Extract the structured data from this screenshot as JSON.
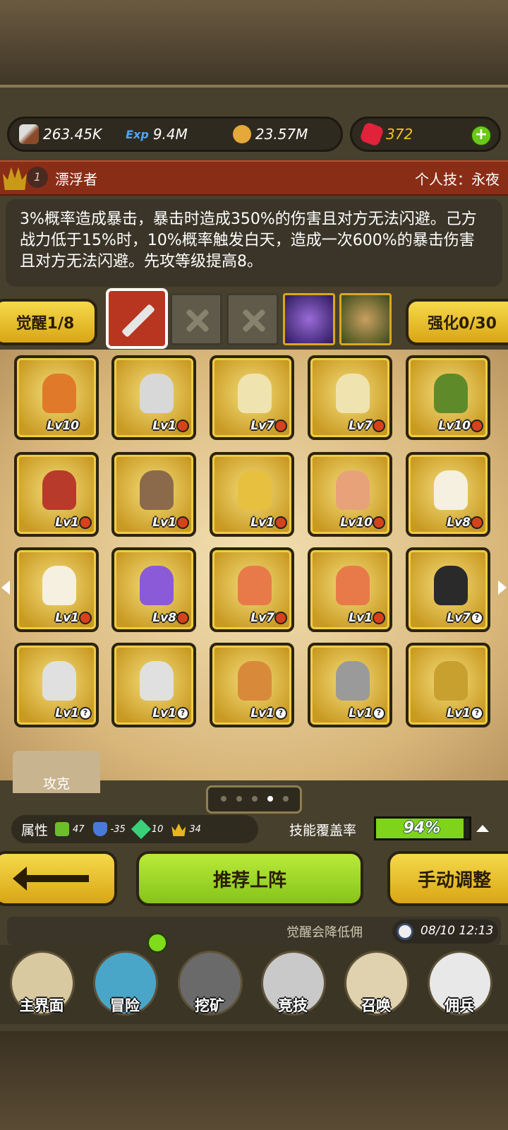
{
  "resources": {
    "power": "263.45K",
    "exp_label": "Exp",
    "exp": "9.4M",
    "gold": "23.57M",
    "gems": "372"
  },
  "hero": {
    "rank": "1",
    "name": "漂浮者",
    "skill": "个人技：永夜",
    "description": "3%概率造成暴击，暴击时造成350%的伤害且对方无法闪避。己方战力低于15%时，10%概率触发白天，造成一次600%的暴击伤害且对方无法闪避。先攻等级提高8。"
  },
  "awaken": {
    "label": "觉醒1/8"
  },
  "enhance": {
    "label": "强化0/30"
  },
  "roster": [
    {
      "level": "Lv10",
      "mark": "",
      "color": "#e07a2a"
    },
    {
      "level": "Lv1",
      "mark": "red",
      "color": "#d8d8d8"
    },
    {
      "level": "Lv7",
      "mark": "red",
      "color": "#efe3b0"
    },
    {
      "level": "Lv7",
      "mark": "red",
      "color": "#efe3b0"
    },
    {
      "level": "Lv10",
      "mark": "red",
      "color": "#5f8a2a"
    },
    {
      "level": "Lv1",
      "mark": "red",
      "color": "#b83a2a"
    },
    {
      "level": "Lv1",
      "mark": "red",
      "color": "#8a6a4a"
    },
    {
      "level": "Lv1",
      "mark": "red",
      "color": "#e8c040"
    },
    {
      "level": "Lv10",
      "mark": "red",
      "color": "#e8a27a"
    },
    {
      "level": "Lv8",
      "mark": "red",
      "color": "#f5f0e0"
    },
    {
      "level": "Lv1",
      "mark": "red",
      "color": "#f5f0e0"
    },
    {
      "level": "Lv8",
      "mark": "red",
      "color": "#8a5ad8"
    },
    {
      "level": "Lv7",
      "mark": "red",
      "color": "#e87a4a"
    },
    {
      "level": "Lv1",
      "mark": "red",
      "color": "#e87a4a"
    },
    {
      "level": "Lv7",
      "mark": "q",
      "color": "#2a2a2a"
    },
    {
      "level": "Lv1",
      "mark": "q",
      "color": "#e0e0e0"
    },
    {
      "level": "Lv1",
      "mark": "q",
      "color": "#e0e0e0"
    },
    {
      "level": "Lv1",
      "mark": "q",
      "color": "#d88a3a"
    },
    {
      "level": "Lv1",
      "mark": "q",
      "color": "#9a9a9a"
    },
    {
      "level": "Lv1",
      "mark": "q",
      "color": "#c8a030"
    }
  ],
  "tab_tank": "攻克",
  "attributes": {
    "label": "属性",
    "values": [
      "47",
      "-35",
      "10",
      "34"
    ]
  },
  "coverage": {
    "label": "技能覆盖率",
    "value": "94%",
    "percent": 94
  },
  "buttons": {
    "recommend": "推荐上阵",
    "manual": "手动调整"
  },
  "notice": {
    "text": "觉醒会降低佣",
    "time": "08/10 12:13"
  },
  "nav": [
    "主界面",
    "冒险",
    "挖矿",
    "竞技",
    "召唤",
    "佣兵"
  ],
  "colors": {
    "gold": "#e6b520",
    "green": "#9bd62a",
    "red_bar": "#8a2d17"
  }
}
